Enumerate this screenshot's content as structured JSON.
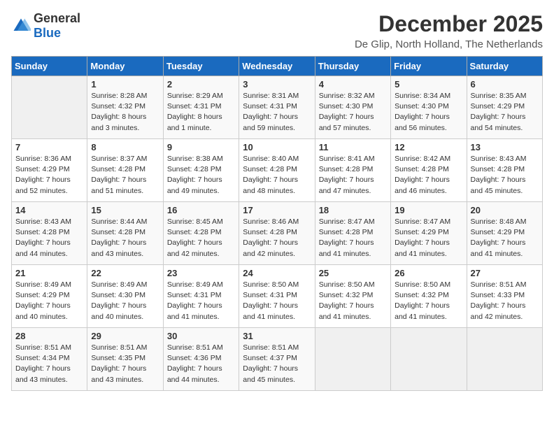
{
  "logo": {
    "general": "General",
    "blue": "Blue"
  },
  "header": {
    "month": "December 2025",
    "location": "De Glip, North Holland, The Netherlands"
  },
  "weekdays": [
    "Sunday",
    "Monday",
    "Tuesday",
    "Wednesday",
    "Thursday",
    "Friday",
    "Saturday"
  ],
  "weeks": [
    [
      {
        "day": "",
        "sunrise": "",
        "sunset": "",
        "daylight": ""
      },
      {
        "day": "1",
        "sunrise": "Sunrise: 8:28 AM",
        "sunset": "Sunset: 4:32 PM",
        "daylight": "Daylight: 8 hours and 3 minutes."
      },
      {
        "day": "2",
        "sunrise": "Sunrise: 8:29 AM",
        "sunset": "Sunset: 4:31 PM",
        "daylight": "Daylight: 8 hours and 1 minute."
      },
      {
        "day": "3",
        "sunrise": "Sunrise: 8:31 AM",
        "sunset": "Sunset: 4:31 PM",
        "daylight": "Daylight: 7 hours and 59 minutes."
      },
      {
        "day": "4",
        "sunrise": "Sunrise: 8:32 AM",
        "sunset": "Sunset: 4:30 PM",
        "daylight": "Daylight: 7 hours and 57 minutes."
      },
      {
        "day": "5",
        "sunrise": "Sunrise: 8:34 AM",
        "sunset": "Sunset: 4:30 PM",
        "daylight": "Daylight: 7 hours and 56 minutes."
      },
      {
        "day": "6",
        "sunrise": "Sunrise: 8:35 AM",
        "sunset": "Sunset: 4:29 PM",
        "daylight": "Daylight: 7 hours and 54 minutes."
      }
    ],
    [
      {
        "day": "7",
        "sunrise": "Sunrise: 8:36 AM",
        "sunset": "Sunset: 4:29 PM",
        "daylight": "Daylight: 7 hours and 52 minutes."
      },
      {
        "day": "8",
        "sunrise": "Sunrise: 8:37 AM",
        "sunset": "Sunset: 4:28 PM",
        "daylight": "Daylight: 7 hours and 51 minutes."
      },
      {
        "day": "9",
        "sunrise": "Sunrise: 8:38 AM",
        "sunset": "Sunset: 4:28 PM",
        "daylight": "Daylight: 7 hours and 49 minutes."
      },
      {
        "day": "10",
        "sunrise": "Sunrise: 8:40 AM",
        "sunset": "Sunset: 4:28 PM",
        "daylight": "Daylight: 7 hours and 48 minutes."
      },
      {
        "day": "11",
        "sunrise": "Sunrise: 8:41 AM",
        "sunset": "Sunset: 4:28 PM",
        "daylight": "Daylight: 7 hours and 47 minutes."
      },
      {
        "day": "12",
        "sunrise": "Sunrise: 8:42 AM",
        "sunset": "Sunset: 4:28 PM",
        "daylight": "Daylight: 7 hours and 46 minutes."
      },
      {
        "day": "13",
        "sunrise": "Sunrise: 8:43 AM",
        "sunset": "Sunset: 4:28 PM",
        "daylight": "Daylight: 7 hours and 45 minutes."
      }
    ],
    [
      {
        "day": "14",
        "sunrise": "Sunrise: 8:43 AM",
        "sunset": "Sunset: 4:28 PM",
        "daylight": "Daylight: 7 hours and 44 minutes."
      },
      {
        "day": "15",
        "sunrise": "Sunrise: 8:44 AM",
        "sunset": "Sunset: 4:28 PM",
        "daylight": "Daylight: 7 hours and 43 minutes."
      },
      {
        "day": "16",
        "sunrise": "Sunrise: 8:45 AM",
        "sunset": "Sunset: 4:28 PM",
        "daylight": "Daylight: 7 hours and 42 minutes."
      },
      {
        "day": "17",
        "sunrise": "Sunrise: 8:46 AM",
        "sunset": "Sunset: 4:28 PM",
        "daylight": "Daylight: 7 hours and 42 minutes."
      },
      {
        "day": "18",
        "sunrise": "Sunrise: 8:47 AM",
        "sunset": "Sunset: 4:28 PM",
        "daylight": "Daylight: 7 hours and 41 minutes."
      },
      {
        "day": "19",
        "sunrise": "Sunrise: 8:47 AM",
        "sunset": "Sunset: 4:29 PM",
        "daylight": "Daylight: 7 hours and 41 minutes."
      },
      {
        "day": "20",
        "sunrise": "Sunrise: 8:48 AM",
        "sunset": "Sunset: 4:29 PM",
        "daylight": "Daylight: 7 hours and 41 minutes."
      }
    ],
    [
      {
        "day": "21",
        "sunrise": "Sunrise: 8:49 AM",
        "sunset": "Sunset: 4:29 PM",
        "daylight": "Daylight: 7 hours and 40 minutes."
      },
      {
        "day": "22",
        "sunrise": "Sunrise: 8:49 AM",
        "sunset": "Sunset: 4:30 PM",
        "daylight": "Daylight: 7 hours and 40 minutes."
      },
      {
        "day": "23",
        "sunrise": "Sunrise: 8:49 AM",
        "sunset": "Sunset: 4:31 PM",
        "daylight": "Daylight: 7 hours and 41 minutes."
      },
      {
        "day": "24",
        "sunrise": "Sunrise: 8:50 AM",
        "sunset": "Sunset: 4:31 PM",
        "daylight": "Daylight: 7 hours and 41 minutes."
      },
      {
        "day": "25",
        "sunrise": "Sunrise: 8:50 AM",
        "sunset": "Sunset: 4:32 PM",
        "daylight": "Daylight: 7 hours and 41 minutes."
      },
      {
        "day": "26",
        "sunrise": "Sunrise: 8:50 AM",
        "sunset": "Sunset: 4:32 PM",
        "daylight": "Daylight: 7 hours and 41 minutes."
      },
      {
        "day": "27",
        "sunrise": "Sunrise: 8:51 AM",
        "sunset": "Sunset: 4:33 PM",
        "daylight": "Daylight: 7 hours and 42 minutes."
      }
    ],
    [
      {
        "day": "28",
        "sunrise": "Sunrise: 8:51 AM",
        "sunset": "Sunset: 4:34 PM",
        "daylight": "Daylight: 7 hours and 43 minutes."
      },
      {
        "day": "29",
        "sunrise": "Sunrise: 8:51 AM",
        "sunset": "Sunset: 4:35 PM",
        "daylight": "Daylight: 7 hours and 43 minutes."
      },
      {
        "day": "30",
        "sunrise": "Sunrise: 8:51 AM",
        "sunset": "Sunset: 4:36 PM",
        "daylight": "Daylight: 7 hours and 44 minutes."
      },
      {
        "day": "31",
        "sunrise": "Sunrise: 8:51 AM",
        "sunset": "Sunset: 4:37 PM",
        "daylight": "Daylight: 7 hours and 45 minutes."
      },
      {
        "day": "",
        "sunrise": "",
        "sunset": "",
        "daylight": ""
      },
      {
        "day": "",
        "sunrise": "",
        "sunset": "",
        "daylight": ""
      },
      {
        "day": "",
        "sunrise": "",
        "sunset": "",
        "daylight": ""
      }
    ]
  ]
}
